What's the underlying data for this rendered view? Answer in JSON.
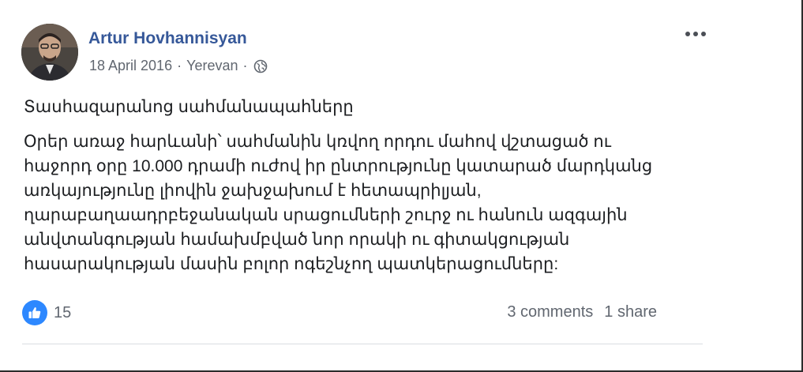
{
  "post": {
    "author": "Artur Hovhannisyan",
    "date": "18 April 2016",
    "separator": "·",
    "location": "Yerevan",
    "privacy_icon": "globe-icon",
    "more_icon": "more-options-icon",
    "title": "Տասհազարանոց սահմանապահները",
    "body_lines": [
      "Օրեր առաջ հարևանի՝ սահմանին կռվող որդու մահով վշտացած ու",
      "հաջորդ օրը 10.000 դրամի ուժով իր ընտրությունը կատարած մարդկանց",
      "առկայությունը լիովին ջախջախում է հետապրիլյան,",
      "ղարաբաղաադրբեջանական սրացումների շուրջ ու հանուն ազգային",
      "անվտանգության համախմբված նոր որակի ու գիտակցության",
      "հասարակության մասին բոլոր ոգեշնչող պատկերացումները:"
    ]
  },
  "footer": {
    "like_icon": "like-icon",
    "reaction_count": "15",
    "comments": "3 comments",
    "shares": "1 share"
  },
  "colors": {
    "author_link": "#365899",
    "meta_text": "#616770",
    "like_blue": "#2d88ff",
    "divider": "#dadde1"
  }
}
